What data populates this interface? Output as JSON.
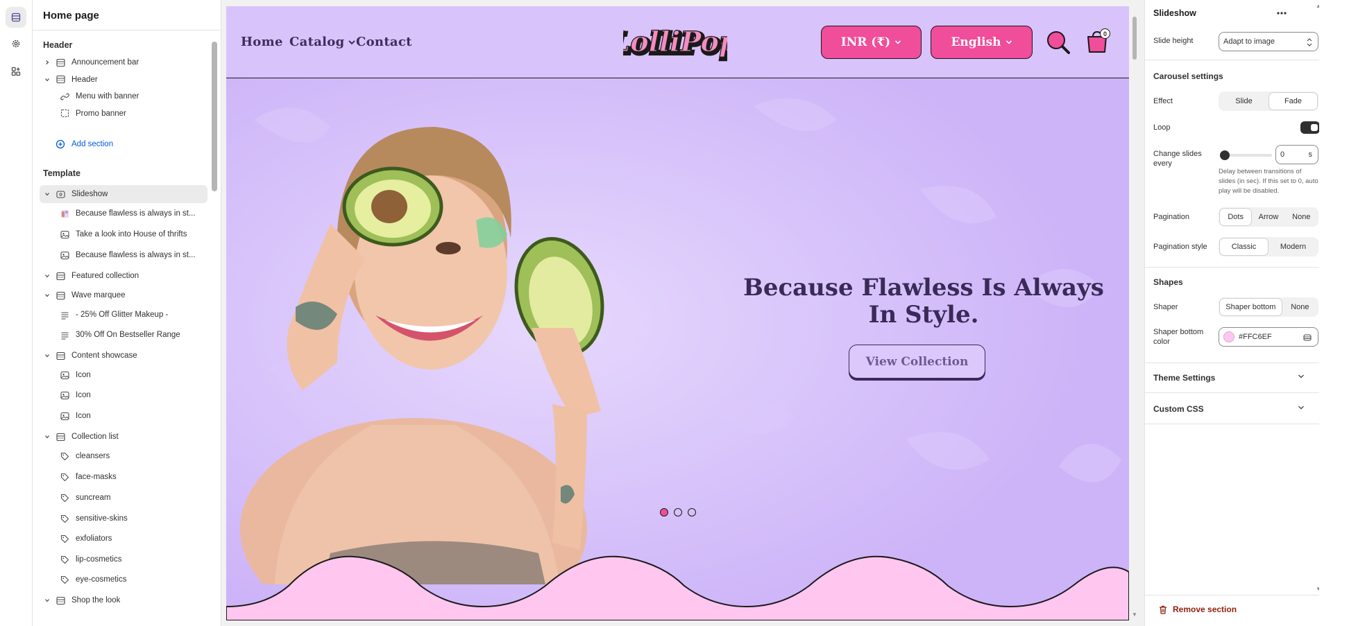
{
  "tree": {
    "title": "Home page",
    "header_group": "Header",
    "header_items": [
      {
        "label": "Announcement bar",
        "level": 1,
        "icon": "section-icon"
      },
      {
        "label": "Header",
        "level": 1,
        "icon": "section-icon"
      },
      {
        "label": "Menu with banner",
        "level": 2,
        "icon": "link-icon"
      },
      {
        "label": "Promo banner",
        "level": 2,
        "icon": "dashed-square-icon"
      }
    ],
    "add_section": "Add section",
    "template_group": "Template",
    "template_items": [
      {
        "label": "Slideshow",
        "level": 1,
        "icon": "slideshow-icon",
        "selected": true
      },
      {
        "label": "Because flawless is always in st...",
        "level": 2,
        "icon": "image-thumb-icon"
      },
      {
        "label": "Take a look into House of thrifts",
        "level": 2,
        "icon": "image-icon"
      },
      {
        "label": "Because flawless is always in st...",
        "level": 2,
        "icon": "image-icon"
      },
      {
        "label": "Featured collection",
        "level": 1,
        "icon": "section-icon"
      },
      {
        "label": "Wave marquee",
        "level": 1,
        "icon": "section-icon"
      },
      {
        "label": "- 25% Off Glitter Makeup -",
        "level": 2,
        "icon": "text-icon"
      },
      {
        "label": "30% Off On Bestseller Range",
        "level": 2,
        "icon": "text-icon"
      },
      {
        "label": "Content showcase",
        "level": 1,
        "icon": "section-icon"
      },
      {
        "label": "Icon",
        "level": 2,
        "icon": "image-icon"
      },
      {
        "label": "Icon",
        "level": 2,
        "icon": "image-icon"
      },
      {
        "label": "Icon",
        "level": 2,
        "icon": "image-icon"
      },
      {
        "label": "Collection list",
        "level": 1,
        "icon": "section-icon"
      },
      {
        "label": "cleansers",
        "level": 2,
        "icon": "tag-icon"
      },
      {
        "label": "face-masks",
        "level": 2,
        "icon": "tag-icon"
      },
      {
        "label": "suncream",
        "level": 2,
        "icon": "tag-icon"
      },
      {
        "label": "sensitive-skins",
        "level": 2,
        "icon": "tag-icon"
      },
      {
        "label": "exfoliators",
        "level": 2,
        "icon": "tag-icon"
      },
      {
        "label": "lip-cosmetics",
        "level": 2,
        "icon": "tag-icon"
      },
      {
        "label": "eye-cosmetics",
        "level": 2,
        "icon": "tag-icon"
      },
      {
        "label": "Shop the look",
        "level": 1,
        "icon": "section-icon"
      }
    ]
  },
  "store": {
    "nav": [
      "Home",
      "Catalog",
      "Contact"
    ],
    "logo_text": "LolliPop",
    "currency": "INR (₹)",
    "language": "English",
    "cart_count": "0",
    "hero_title": "Because Flawless Is Always In Style.",
    "hero_button": "View Collection",
    "slides": 3,
    "active_slide": 1,
    "colors": {
      "header_bg": "#d9c3fb",
      "accent": "#f04d9a",
      "hero_bg": "#d8c4fb",
      "shaper": "#ffc6ef",
      "title": "#3a2a58"
    }
  },
  "settings": {
    "title": "Slideshow",
    "slide_height_label": "Slide height",
    "slide_height_value": "Adapt to image",
    "carousel_heading": "Carousel settings",
    "effect_label": "Effect",
    "effect_options": [
      "Slide",
      "Fade"
    ],
    "effect_selected": "Fade",
    "loop_label": "Loop",
    "loop_on": true,
    "change_label": "Change slides every",
    "change_value": "0",
    "change_unit": "s",
    "change_help": "Delay between transitions of slides (in sec). If this set to 0, auto play will be disabled.",
    "pagination_label": "Pagination",
    "pagination_options": [
      "Dots",
      "Arrow",
      "None"
    ],
    "pagination_selected": "Dots",
    "pagination_style_label": "Pagination style",
    "pagination_style_options": [
      "Classic",
      "Modern"
    ],
    "pagination_style_selected": "Classic",
    "shapes_heading": "Shapes",
    "shaper_label": "Shaper",
    "shaper_options": [
      "Shaper bottom",
      "None"
    ],
    "shaper_selected": "Shaper bottom",
    "shaper_color_label": "Shaper bottom color",
    "shaper_color_value": "#FFC6EF",
    "theme_settings": "Theme Settings",
    "custom_css": "Custom CSS",
    "remove_section": "Remove section"
  }
}
